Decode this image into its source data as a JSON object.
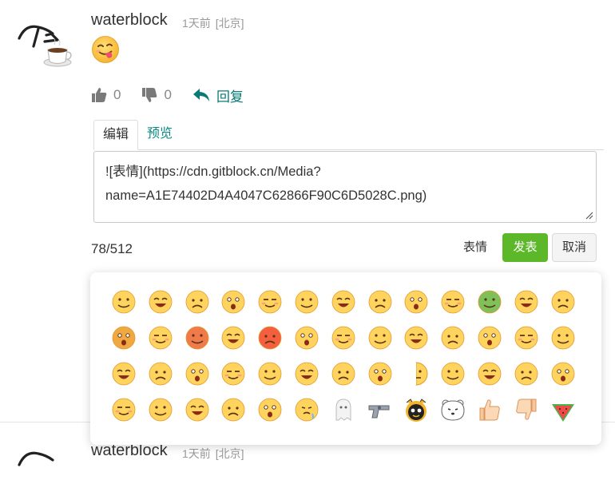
{
  "comment": {
    "username": "waterblock",
    "time": "1天前",
    "location": "[北京]",
    "post_emoji": "tongue-out-smiley-icon"
  },
  "actions": {
    "like_count": "0",
    "dislike_count": "0",
    "reply_label": "回复"
  },
  "editor": {
    "tab_edit": "编辑",
    "tab_preview": "预览",
    "text": "![表情](https://cdn.gitblock.cn/Media?\nname=A1E74402D4A4047C62866F90C6D5028C.png)",
    "counter": "78/512",
    "emoji_button": "表情",
    "post_button": "发表",
    "cancel_button": "取消"
  },
  "next_comment": {
    "username": "waterblock",
    "time": "1天前",
    "location": "[北京]"
  },
  "emoji_panel": {
    "rows": [
      [
        "smile",
        "awkward",
        "glasses-grin",
        "frown",
        "cry-laugh",
        "tongue-angry",
        "sparkle-eyes",
        "doge",
        "rub-chin",
        "vomit",
        "cabbage-dog",
        "sunglasses-blood",
        "laugh-tears"
      ],
      [
        "shiba",
        "tongue-wink",
        "flame-mask",
        "teary-eyes",
        "angry-red",
        "blush-smile",
        "facepalm",
        "thinking-sweat",
        "cool-shades",
        "crying-river",
        "question",
        "shocked",
        "sad"
      ],
      [
        "pout",
        "smirk",
        "hand-mouth",
        "peek",
        "grinning-hands",
        "laughing-covering",
        "computer",
        "hide",
        "half-face",
        "open-mouth",
        "puzzled",
        "bruised",
        "tongue-chew"
      ],
      [
        "cheer",
        "cry-loud",
        "happy-blush",
        "big-grin",
        "chili",
        "heartache",
        "ghost",
        "revolver",
        "bear-cat",
        "polar-bear",
        "thumbs-up",
        "thumbs-down",
        "watermelon"
      ]
    ]
  }
}
